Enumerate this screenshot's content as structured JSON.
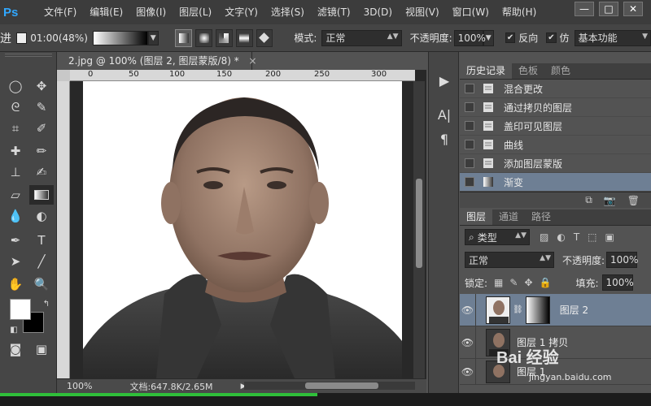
{
  "app": {
    "logo": "Ps"
  },
  "menu": [
    "文件(F)",
    "编辑(E)",
    "图像(I)",
    "图层(L)",
    "文字(Y)",
    "选择(S)",
    "滤镜(T)",
    "3D(D)",
    "视图(V)",
    "窗口(W)",
    "帮助(H)"
  ],
  "window_buttons": {
    "minimize": "—",
    "restore": "□",
    "close": "✕"
  },
  "options": {
    "left_overlay": "进",
    "timestamp": "01:00(48%)",
    "mode_label": "模式:",
    "mode_value": "正常",
    "opacity_label": "不透明度:",
    "opacity_value": "100%",
    "reverse_label": "反向",
    "dither_label": "仿",
    "workspace": "基本功能"
  },
  "document": {
    "tab_title": "2.jpg @ 100% (图层 2, 图层蒙版/8) *",
    "tab_close": "×",
    "ruler_labels": [
      "0",
      "50",
      "100",
      "150",
      "200",
      "250",
      "300"
    ],
    "zoom": "100%",
    "doc_info": "文档:647.8K/2.65M"
  },
  "history": {
    "tabs": [
      "历史记录",
      "色板",
      "颜色"
    ],
    "items": [
      {
        "label": "混合更改",
        "selected": false
      },
      {
        "label": "通过拷贝的图层",
        "selected": false
      },
      {
        "label": "盖印可见图层",
        "selected": false
      },
      {
        "label": "曲线",
        "selected": false
      },
      {
        "label": "添加图层蒙版",
        "selected": false
      },
      {
        "label": "渐变",
        "selected": true
      }
    ]
  },
  "layers": {
    "tabs": [
      "图层",
      "通道",
      "路径"
    ],
    "filter_label": "类型",
    "blend_mode": "正常",
    "opacity_label": "不透明度:",
    "opacity_value": "100%",
    "lock_label": "锁定:",
    "fill_label": "填充:",
    "fill_value": "100%",
    "items": [
      {
        "name": "图层 2",
        "selected": true
      },
      {
        "name": "图层 1 拷贝",
        "selected": false
      },
      {
        "name": "图层 1",
        "selected": false
      }
    ]
  },
  "watermark": {
    "brand": "Bai 经验",
    "url": "jingyan.baidu.com"
  }
}
